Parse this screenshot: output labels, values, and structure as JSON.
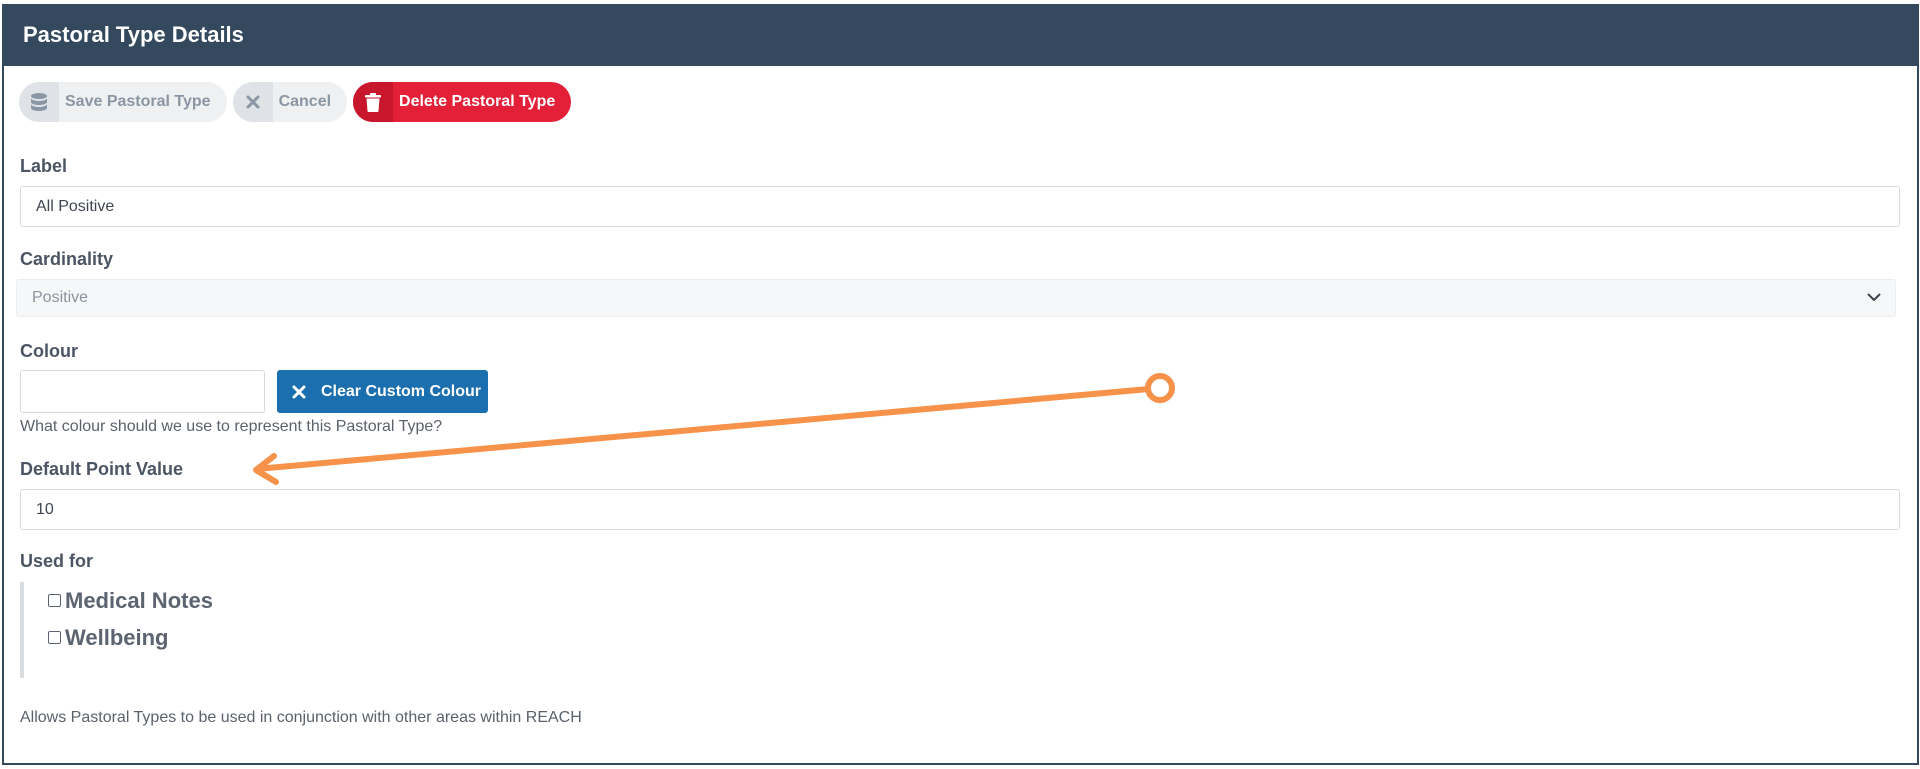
{
  "panel": {
    "title": "Pastoral Type Details"
  },
  "toolbar": {
    "save_label": "Save Pastoral Type",
    "cancel_label": "Cancel",
    "delete_label": "Delete Pastoral Type"
  },
  "form": {
    "label": {
      "label": "Label",
      "value": "All Positive"
    },
    "cardinality": {
      "label": "Cardinality",
      "selected": "Positive"
    },
    "colour": {
      "label": "Colour",
      "value": "",
      "clear_button": "Clear Custom Colour",
      "help": "What colour should we use to represent this Pastoral Type?"
    },
    "default_point_value": {
      "label": "Default Point Value",
      "value": "10"
    },
    "used_for": {
      "label": "Used for",
      "options": [
        {
          "label": "Medical Notes",
          "checked": false
        },
        {
          "label": "Wellbeing",
          "checked": false
        }
      ],
      "help": "Allows Pastoral Types to be used in conjunction with other areas within REACH"
    }
  },
  "annotation": {
    "color": "#f7924a"
  },
  "colors": {
    "header_bg": "#34485e",
    "danger": "#e32037",
    "primary": "#1b6fae"
  }
}
